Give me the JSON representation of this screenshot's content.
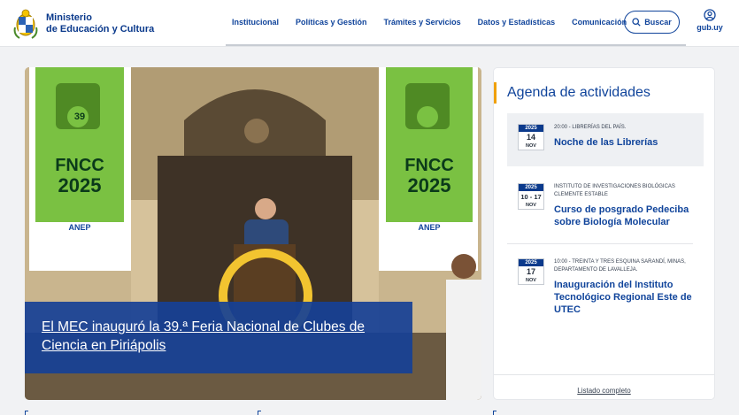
{
  "header": {
    "org_line1": "Ministerio",
    "org_line2": "de Educación y Cultura",
    "nav": [
      "Institucional",
      "Políticas y Gestión",
      "Trámites y Servicios",
      "Datos y Estadísticas",
      "Comunicación"
    ],
    "search_label": "Buscar",
    "gub_label": "gub.uy"
  },
  "hero": {
    "headline": "El MEC inauguró la 39.ª Feria Nacional de Clubes de Ciencia en Piriápolis",
    "banner_number": "39",
    "banner_line1": "FNCC",
    "banner_line2": "2025",
    "banner_org": "ANEP"
  },
  "agenda": {
    "title": "Agenda de actividades",
    "events": [
      {
        "year": "2025",
        "day": "14",
        "month": "NOV",
        "meta": "20:00 - LIBRERÍAS DEL PAÍS.",
        "title": "Noche de las Librerías"
      },
      {
        "year": "2025",
        "day": "10 - 17",
        "month": "NOV",
        "meta": "INSTITUTO DE INVESTIGACIONES BIOLÓGICAS CLEMENTE ESTABLE",
        "title": "Curso de posgrado Pedeciba sobre Biología Molecular"
      },
      {
        "year": "2025",
        "day": "17",
        "month": "NOV",
        "meta": "10:00 - TREINTA Y TRES ESQUINA SARANDÍ, MINAS, DEPARTAMENTO DE LAVALLEJA.",
        "title": "Inauguración del Instituto Tecnológico Regional Este de UTEC"
      }
    ],
    "listado_label": "Listado completo"
  },
  "colors": {
    "primary": "#10449b",
    "accent": "#f0a000",
    "banner_green": "#7ac142"
  }
}
